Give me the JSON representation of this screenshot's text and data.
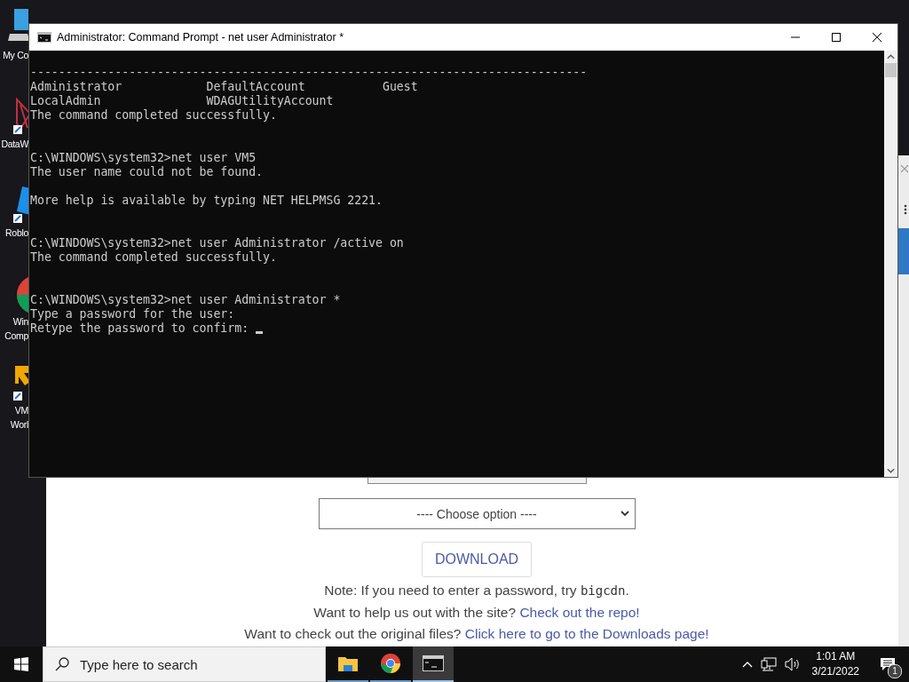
{
  "desktop_icons": [
    {
      "kind": "computer",
      "label": [
        "My Co"
      ]
    },
    {
      "kind": "drawing",
      "label": [
        "DataW"
      ]
    },
    {
      "kind": "roblox",
      "label": [
        "Roblo"
      ]
    },
    {
      "kind": "chrome",
      "label": [
        "Win",
        "Comp"
      ]
    },
    {
      "kind": "vmware",
      "label": [
        "VM",
        "Worl"
      ]
    }
  ],
  "console_window": {
    "title": "Administrator: Command Prompt - net  user Administrator *",
    "lines": [
      {
        "kind": "text",
        "text": "-------------------------------------------------------------------------------"
      },
      {
        "kind": "text",
        "text": "Administrator            DefaultAccount           Guest"
      },
      {
        "kind": "text",
        "text": "LocalAdmin               WDAGUtilityAccount"
      },
      {
        "kind": "text",
        "text": "The command completed successfully."
      },
      {
        "kind": "blank"
      },
      {
        "kind": "blank"
      },
      {
        "kind": "text",
        "text": "C:\\WINDOWS\\system32>net user VM5"
      },
      {
        "kind": "text",
        "text": "The user name could not be found."
      },
      {
        "kind": "blank"
      },
      {
        "kind": "text",
        "text": "More help is available by typing NET HELPMSG 2221."
      },
      {
        "kind": "blank"
      },
      {
        "kind": "blank"
      },
      {
        "kind": "text",
        "text": "C:\\WINDOWS\\system32>net user Administrator /active on"
      },
      {
        "kind": "text",
        "text": "The command completed successfully."
      },
      {
        "kind": "blank"
      },
      {
        "kind": "blank"
      },
      {
        "kind": "text",
        "text": "C:\\WINDOWS\\system32>net user Administrator *"
      },
      {
        "kind": "text",
        "text": "Type a password for the user:"
      },
      {
        "kind": "text",
        "text": "Retype the password to confirm: ",
        "cursor": true
      }
    ]
  },
  "browser_page": {
    "select": {
      "value": "---- Choose option ----"
    },
    "download_button": "DOWNLOAD",
    "paragraphs": [
      [
        {
          "kind": "text",
          "text": "Note: If you need to enter a password, try "
        },
        {
          "kind": "code",
          "text": "bigcdn"
        },
        {
          "kind": "text",
          "text": "."
        }
      ],
      [
        {
          "kind": "text",
          "text": "Want to help us out with the site? "
        },
        {
          "kind": "link",
          "text": "Check out the repo!"
        }
      ],
      [
        {
          "kind": "text",
          "text": "Want to check out the original files? "
        },
        {
          "kind": "link",
          "text": "Click here to go to the Downloads page!"
        }
      ]
    ]
  },
  "taskbar": {
    "search_placeholder": "Type here to search",
    "apps": [
      {
        "kind": "explorer",
        "selected": false
      },
      {
        "kind": "chrome",
        "selected": false
      },
      {
        "kind": "terminal",
        "selected": true
      }
    ],
    "time": "1:01 AM",
    "date": "3/21/2022",
    "notification_count": "1"
  }
}
